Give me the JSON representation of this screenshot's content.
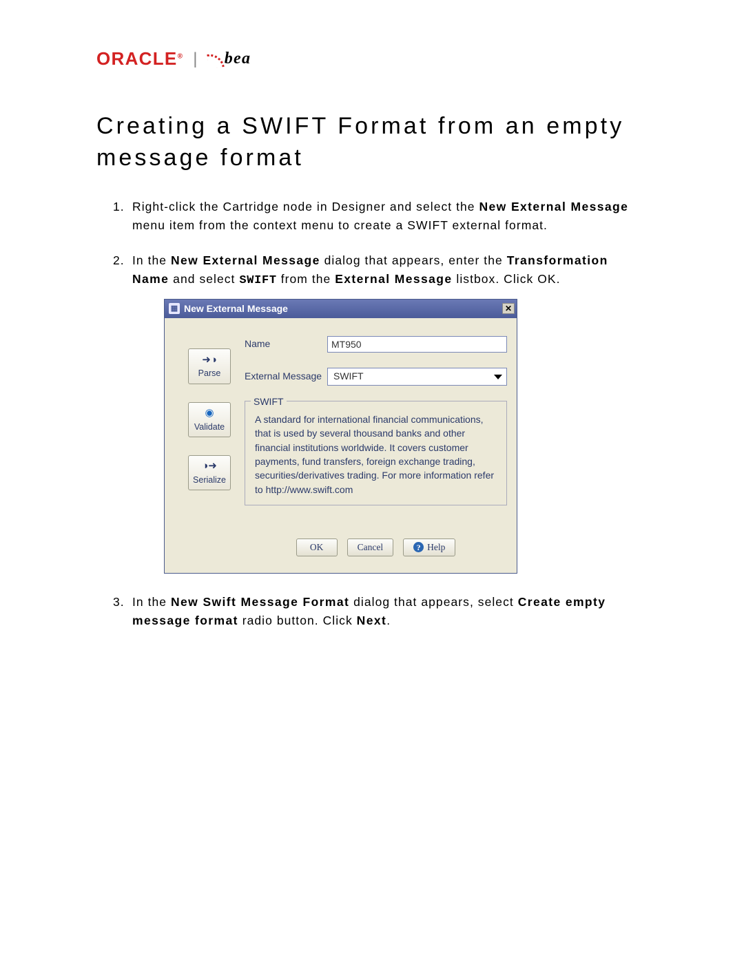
{
  "logo": {
    "oracle": "ORACLE",
    "bea": "bea"
  },
  "heading": "Creating a SWIFT Format from an empty message format",
  "steps": {
    "s1": {
      "num": "1.",
      "t1": "Right-click the Cartridge node in Designer and select the ",
      "b1": "New External Message",
      "t2": " menu item from the context menu to create a SWIFT external format."
    },
    "s2": {
      "num": "2.",
      "t1": "In the ",
      "b1": "New External Message",
      "t2": " dialog that appears, enter the ",
      "b2": "Transformation Name",
      "t3": " and select ",
      "code": "SWIFT",
      "t4": " from the ",
      "b3": "External Message",
      "t5": "  listbox.  Click OK."
    },
    "s3": {
      "num": "3.",
      "t1": "In the ",
      "b1": "New Swift Message Format",
      "t2": " dialog that appears, select ",
      "b2": "Create empty message format",
      "t3": " radio button.  Click ",
      "b3": "Next",
      "t4": "."
    }
  },
  "dialog": {
    "title": "New External Message",
    "side": {
      "parse": "Parse",
      "validate": "Validate",
      "serialize": "Serialize"
    },
    "name_label": "Name",
    "name_value": "MT950",
    "extmsg_label": "External Message",
    "extmsg_value": "SWIFT",
    "group_legend": "SWIFT",
    "group_desc": "A standard for international financial communications, that is used by several thousand banks and other financial institutions worldwide. It covers customer payments, fund transfers, foreign exchange trading, securities/derivatives trading. For more information refer to http://www.swift.com",
    "ok": "OK",
    "cancel": "Cancel",
    "help": "Help"
  }
}
